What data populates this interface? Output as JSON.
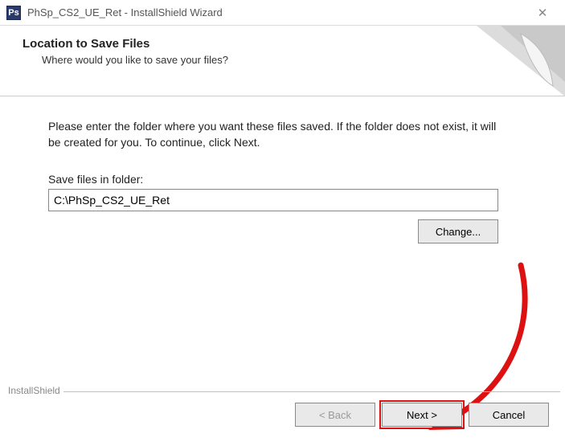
{
  "titlebar": {
    "icon_text": "Ps",
    "title": "PhSp_CS2_UE_Ret - InstallShield Wizard",
    "close_glyph": "✕"
  },
  "header": {
    "title": "Location to Save Files",
    "subtitle": "Where would you like to save your files?"
  },
  "content": {
    "instruction": "Please enter the folder where you want these files saved.  If the folder does not exist, it will be created for you.   To continue, click Next.",
    "field_label": "Save files in folder:",
    "path_value": "C:\\PhSp_CS2_UE_Ret",
    "change_label": "Change..."
  },
  "footer": {
    "brand": "InstallShield",
    "back_label": "< Back",
    "next_label": "Next >",
    "cancel_label": "Cancel"
  }
}
